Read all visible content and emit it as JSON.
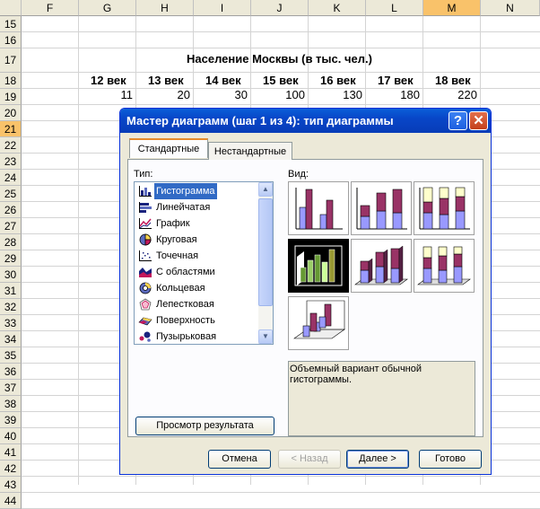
{
  "spreadsheet": {
    "columns": [
      "F",
      "G",
      "H",
      "I",
      "J",
      "K",
      "L",
      "M",
      "N"
    ],
    "selected_column": "M",
    "rows": [
      "15",
      "16",
      "17",
      "18",
      "19",
      "20",
      "21",
      "22",
      "23",
      "24",
      "25",
      "26",
      "27",
      "28",
      "29",
      "30",
      "31",
      "32",
      "33",
      "34",
      "35",
      "36",
      "37",
      "38",
      "39",
      "40",
      "41",
      "42",
      "43",
      "44"
    ],
    "selected_row": "21",
    "table_title": "Население Москвы (в тыс. чел.)",
    "headers": [
      "12 век",
      "13 век",
      "14 век",
      "15 век",
      "16 век",
      "17 век",
      "18 век"
    ],
    "values": [
      "11",
      "20",
      "30",
      "100",
      "130",
      "180",
      "220"
    ]
  },
  "dialog": {
    "title": "Мастер диаграмм (шаг 1 из 4): тип диаграммы",
    "help_label": "?",
    "close_label": "✕",
    "tabs": [
      {
        "label": "Стандартные"
      },
      {
        "label": "Нестандартные"
      }
    ],
    "type_label": "Тип:",
    "view_label": "Вид:",
    "chart_types": [
      {
        "label": "Гистограмма",
        "icon": "column-chart-icon"
      },
      {
        "label": "Линейчатая",
        "icon": "bar-chart-icon"
      },
      {
        "label": "График",
        "icon": "line-chart-icon"
      },
      {
        "label": "Круговая",
        "icon": "pie-chart-icon"
      },
      {
        "label": "Точечная",
        "icon": "scatter-chart-icon"
      },
      {
        "label": "С областями",
        "icon": "area-chart-icon"
      },
      {
        "label": "Кольцевая",
        "icon": "doughnut-chart-icon"
      },
      {
        "label": "Лепестковая",
        "icon": "radar-chart-icon"
      },
      {
        "label": "Поверхность",
        "icon": "surface-chart-icon"
      },
      {
        "label": "Пузырьковая",
        "icon": "bubble-chart-icon"
      }
    ],
    "selected_type": "Гистограмма",
    "description": "Объемный вариант обычной гистограммы.",
    "buttons": {
      "preview": "Просмотр результата",
      "cancel": "Отмена",
      "back": "< Назад",
      "next": "Далее >",
      "finish": "Готово"
    },
    "colors": {
      "accent": "#316ac5",
      "series1": "#993366",
      "series2": "#9999ff",
      "series3": "#ffffcc"
    }
  }
}
